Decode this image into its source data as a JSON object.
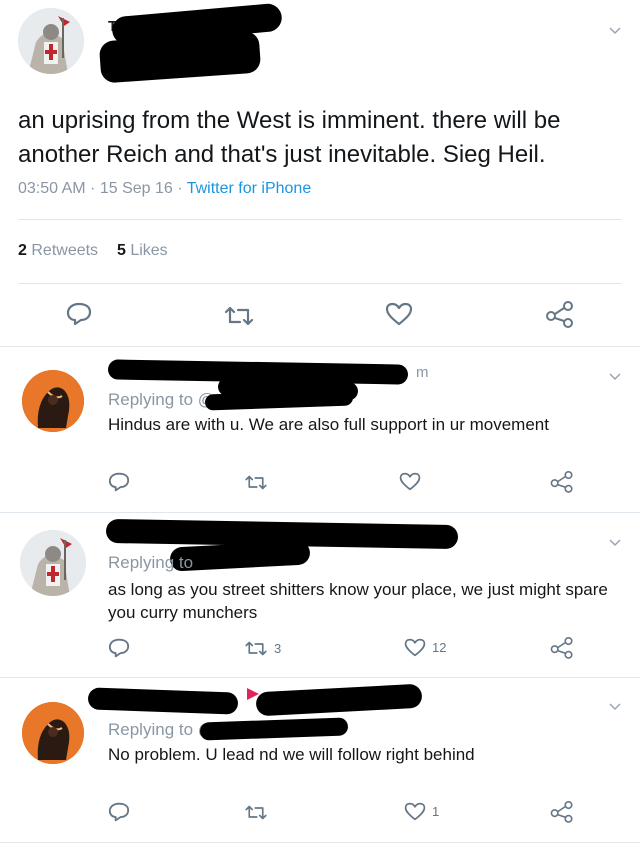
{
  "main_tweet": {
    "text": "an uprising from the West is imminent. there will be another Reich and that's just inevitable. Sieg Heil.",
    "time": "03:50 AM",
    "date": "15 Sep 16",
    "client": "Twitter for iPhone",
    "retweets_count": "2",
    "retweets_label": "Retweets",
    "likes_count": "5",
    "likes_label": "Likes",
    "name_fragment": "Th"
  },
  "replies": [
    {
      "replying_to": "Replying to @",
      "text": "Hindus are with u. We are also full support in ur movement",
      "retweet_count": "",
      "like_count": "",
      "time_fragment": "m"
    },
    {
      "replying_to": "Replying to",
      "text": "as long as you street shitters know your place, we just might spare you curry munchers",
      "retweet_count": "3",
      "like_count": "12"
    },
    {
      "replying_to": "Replying to @",
      "text": "No problem. U lead nd we will follow right behind",
      "retweet_count": "",
      "like_count": "1"
    }
  ],
  "icons": {
    "reply": "reply-icon",
    "retweet": "retweet-icon",
    "like": "heart-icon",
    "share": "share-icon",
    "more": "chevron-down-icon"
  },
  "colors": {
    "link": "#1b95e0",
    "muted": "#8a96a3",
    "divider": "#e1e8ed",
    "redaction": "#000000"
  }
}
